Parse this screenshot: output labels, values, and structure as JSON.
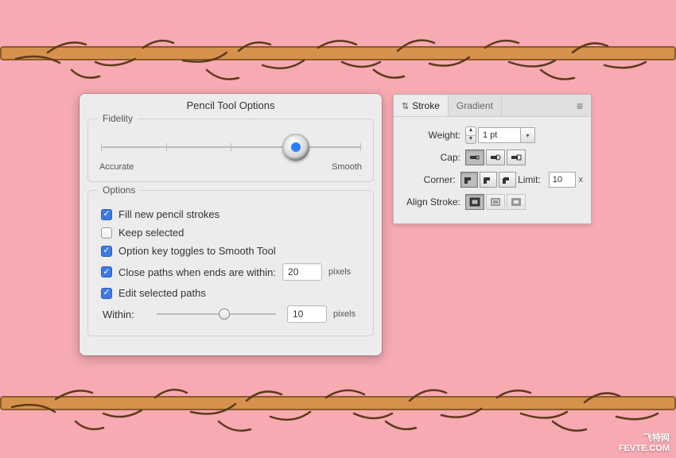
{
  "dialog": {
    "title": "Pencil Tool Options",
    "fidelity": {
      "section_label": "Fidelity",
      "left_label": "Accurate",
      "right_label": "Smooth"
    },
    "options": {
      "section_label": "Options",
      "fill_new": {
        "label": "Fill new pencil strokes",
        "checked": true
      },
      "keep_selected": {
        "label": "Keep selected",
        "checked": false
      },
      "option_key": {
        "label": "Option key toggles to Smooth Tool",
        "checked": true
      },
      "close_paths": {
        "label": "Close paths when ends are within:",
        "checked": true,
        "value": "20",
        "unit": "pixels"
      },
      "edit_selected": {
        "label": "Edit selected paths",
        "checked": true
      },
      "within": {
        "label": "Within:",
        "value": "10",
        "unit": "pixels"
      }
    }
  },
  "panel": {
    "tabs": {
      "stroke": "Stroke",
      "gradient": "Gradient"
    },
    "weight": {
      "label": "Weight:",
      "value": "1 pt"
    },
    "cap": {
      "label": "Cap:"
    },
    "corner": {
      "label": "Corner:"
    },
    "limit": {
      "label": "Limit:",
      "value": "10",
      "suffix": "x"
    },
    "align": {
      "label": "Align Stroke:"
    }
  },
  "watermark": {
    "line1": "飞特网",
    "line2": "FEVTE.COM"
  }
}
